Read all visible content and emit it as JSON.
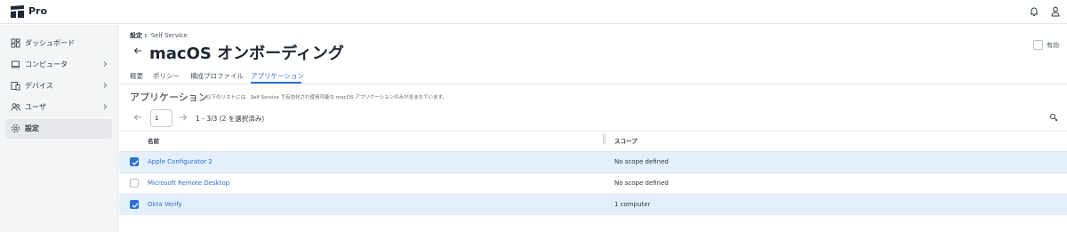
{
  "app": {
    "name": "Pro"
  },
  "topbar": {
    "icons": [
      "bell-icon",
      "user-icon"
    ]
  },
  "sidebar": {
    "items": [
      {
        "label": "ダッシュボード",
        "icon": "dashboard-icon",
        "chevron": false,
        "active": false
      },
      {
        "label": "コンピュータ",
        "icon": "computer-icon",
        "chevron": true,
        "active": false
      },
      {
        "label": "デバイス",
        "icon": "devices-icon",
        "chevron": true,
        "active": false
      },
      {
        "label": "ユーザ",
        "icon": "users-icon",
        "chevron": true,
        "active": false
      },
      {
        "label": "設定",
        "icon": "gear-icon",
        "chevron": false,
        "active": true
      }
    ]
  },
  "breadcrumb": {
    "root": "設定 :",
    "current": "Self Service"
  },
  "page": {
    "title": "macOS オンボーディング",
    "enabled_label": "有効",
    "enabled": false
  },
  "tabs": [
    {
      "label": "概要",
      "active": false
    },
    {
      "label": "ポリシー",
      "active": false
    },
    {
      "label": "構成プロファイル",
      "active": false
    },
    {
      "label": "アプリケーション",
      "active": true
    }
  ],
  "section": {
    "title": "アプリケーション",
    "description": "以下のリストには、Self Service で有効化され使用可能な macOS アプリケーションのみが含まれています。"
  },
  "pager": {
    "page": "1",
    "info": "1 - 3/3 (2 を選択済み)"
  },
  "table": {
    "columns": [
      "名前",
      "スコープ"
    ],
    "rows": [
      {
        "name": "Apple Configurator 2",
        "scope": "No scope defined",
        "selected": true
      },
      {
        "name": "Microsoft Remote Desktop",
        "scope": "No scope defined",
        "selected": false
      },
      {
        "name": "Okta Verify",
        "scope": "1 computer",
        "selected": true
      }
    ]
  },
  "colors": {
    "accent": "#2c6ed6",
    "selected_row": "#e3f0fc",
    "sidebar_bg": "#f4f5f7"
  }
}
